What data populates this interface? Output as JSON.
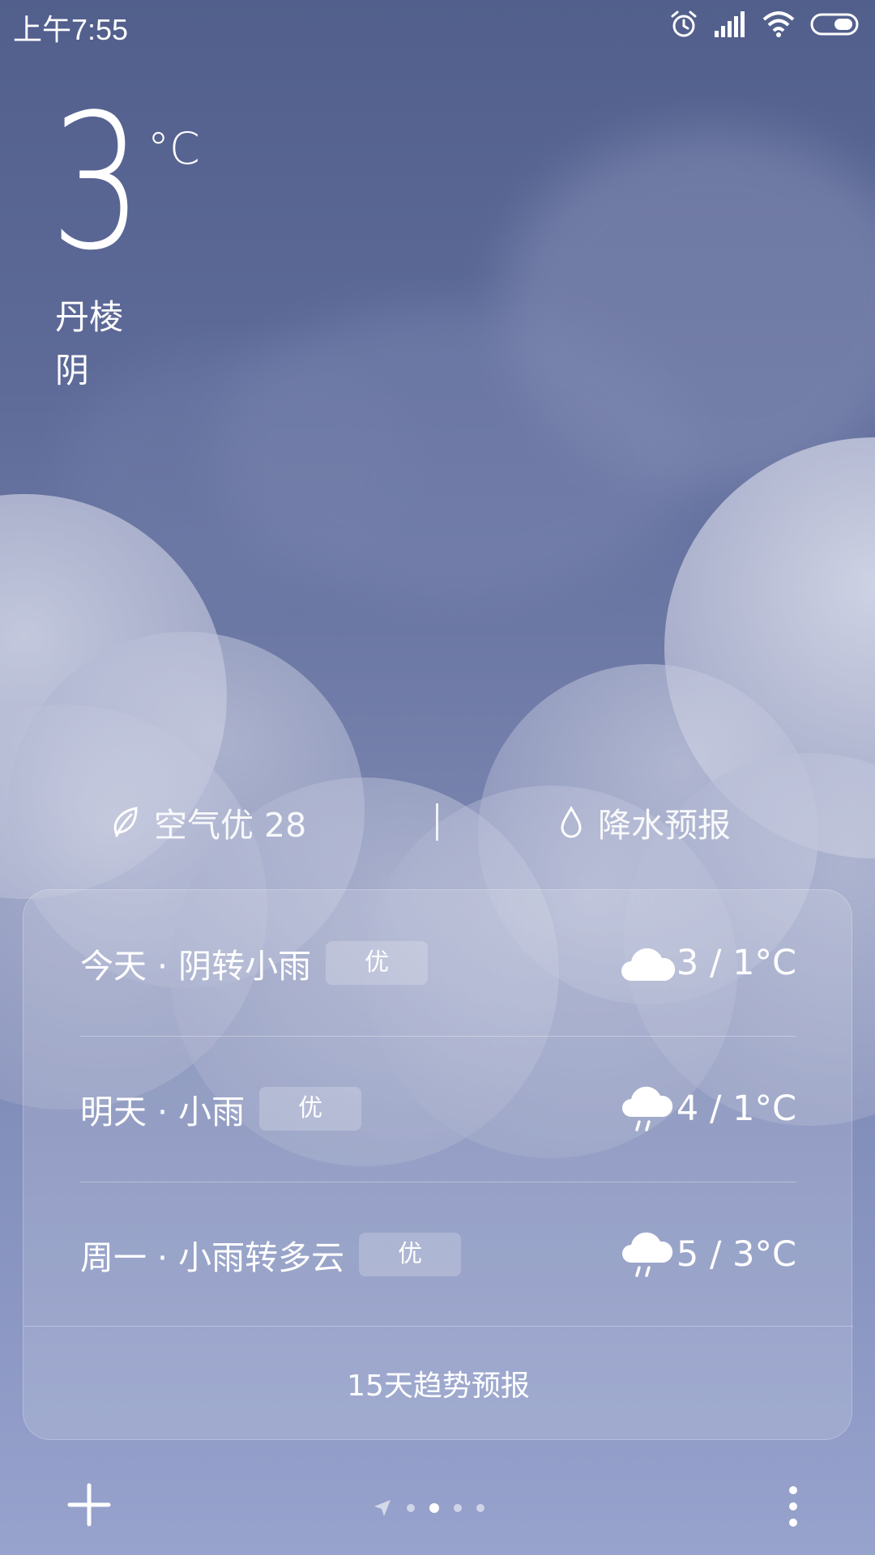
{
  "status_bar": {
    "time": "上午7:55",
    "icons": [
      "alarm-icon",
      "signal-icon",
      "wifi-icon",
      "battery-icon"
    ]
  },
  "current": {
    "temperature": "3",
    "unit": "°C",
    "city": "丹棱",
    "condition": "阴"
  },
  "info_row": {
    "air_quality": "空气优 28",
    "air_icon": "leaf-icon",
    "precipitation": "降水预报",
    "precip_icon": "water-drop-icon"
  },
  "forecast": {
    "days": [
      {
        "label": "今天 · 阴转小雨",
        "aqi": "优",
        "icon": "cloud-icon",
        "temps": "3 / 1°C"
      },
      {
        "label": "明天 · 小雨",
        "aqi": "优",
        "icon": "rain-cloud-icon",
        "temps": "4 / 1°C"
      },
      {
        "label": "周一 · 小雨转多云",
        "aqi": "优",
        "icon": "rain-cloud-icon",
        "temps": "5 / 3°C"
      }
    ],
    "trend_link": "15天趋势预报"
  },
  "bottom_bar": {
    "add_icon": "plus-icon",
    "page_count": 4,
    "active_page": 1,
    "more_icon": "more-vertical-icon"
  }
}
